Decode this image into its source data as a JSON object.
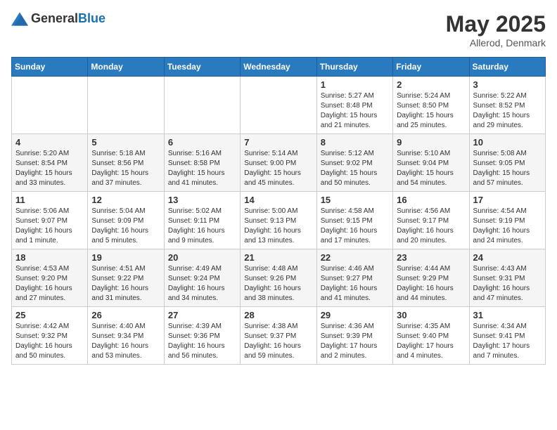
{
  "header": {
    "logo_general": "General",
    "logo_blue": "Blue",
    "month_title": "May 2025",
    "subtitle": "Allerod, Denmark"
  },
  "weekdays": [
    "Sunday",
    "Monday",
    "Tuesday",
    "Wednesday",
    "Thursday",
    "Friday",
    "Saturday"
  ],
  "weeks": [
    [
      {
        "day": "",
        "info": ""
      },
      {
        "day": "",
        "info": ""
      },
      {
        "day": "",
        "info": ""
      },
      {
        "day": "",
        "info": ""
      },
      {
        "day": "1",
        "info": "Sunrise: 5:27 AM\nSunset: 8:48 PM\nDaylight: 15 hours\nand 21 minutes."
      },
      {
        "day": "2",
        "info": "Sunrise: 5:24 AM\nSunset: 8:50 PM\nDaylight: 15 hours\nand 25 minutes."
      },
      {
        "day": "3",
        "info": "Sunrise: 5:22 AM\nSunset: 8:52 PM\nDaylight: 15 hours\nand 29 minutes."
      }
    ],
    [
      {
        "day": "4",
        "info": "Sunrise: 5:20 AM\nSunset: 8:54 PM\nDaylight: 15 hours\nand 33 minutes."
      },
      {
        "day": "5",
        "info": "Sunrise: 5:18 AM\nSunset: 8:56 PM\nDaylight: 15 hours\nand 37 minutes."
      },
      {
        "day": "6",
        "info": "Sunrise: 5:16 AM\nSunset: 8:58 PM\nDaylight: 15 hours\nand 41 minutes."
      },
      {
        "day": "7",
        "info": "Sunrise: 5:14 AM\nSunset: 9:00 PM\nDaylight: 15 hours\nand 45 minutes."
      },
      {
        "day": "8",
        "info": "Sunrise: 5:12 AM\nSunset: 9:02 PM\nDaylight: 15 hours\nand 50 minutes."
      },
      {
        "day": "9",
        "info": "Sunrise: 5:10 AM\nSunset: 9:04 PM\nDaylight: 15 hours\nand 54 minutes."
      },
      {
        "day": "10",
        "info": "Sunrise: 5:08 AM\nSunset: 9:05 PM\nDaylight: 15 hours\nand 57 minutes."
      }
    ],
    [
      {
        "day": "11",
        "info": "Sunrise: 5:06 AM\nSunset: 9:07 PM\nDaylight: 16 hours\nand 1 minute."
      },
      {
        "day": "12",
        "info": "Sunrise: 5:04 AM\nSunset: 9:09 PM\nDaylight: 16 hours\nand 5 minutes."
      },
      {
        "day": "13",
        "info": "Sunrise: 5:02 AM\nSunset: 9:11 PM\nDaylight: 16 hours\nand 9 minutes."
      },
      {
        "day": "14",
        "info": "Sunrise: 5:00 AM\nSunset: 9:13 PM\nDaylight: 16 hours\nand 13 minutes."
      },
      {
        "day": "15",
        "info": "Sunrise: 4:58 AM\nSunset: 9:15 PM\nDaylight: 16 hours\nand 17 minutes."
      },
      {
        "day": "16",
        "info": "Sunrise: 4:56 AM\nSunset: 9:17 PM\nDaylight: 16 hours\nand 20 minutes."
      },
      {
        "day": "17",
        "info": "Sunrise: 4:54 AM\nSunset: 9:19 PM\nDaylight: 16 hours\nand 24 minutes."
      }
    ],
    [
      {
        "day": "18",
        "info": "Sunrise: 4:53 AM\nSunset: 9:20 PM\nDaylight: 16 hours\nand 27 minutes."
      },
      {
        "day": "19",
        "info": "Sunrise: 4:51 AM\nSunset: 9:22 PM\nDaylight: 16 hours\nand 31 minutes."
      },
      {
        "day": "20",
        "info": "Sunrise: 4:49 AM\nSunset: 9:24 PM\nDaylight: 16 hours\nand 34 minutes."
      },
      {
        "day": "21",
        "info": "Sunrise: 4:48 AM\nSunset: 9:26 PM\nDaylight: 16 hours\nand 38 minutes."
      },
      {
        "day": "22",
        "info": "Sunrise: 4:46 AM\nSunset: 9:27 PM\nDaylight: 16 hours\nand 41 minutes."
      },
      {
        "day": "23",
        "info": "Sunrise: 4:44 AM\nSunset: 9:29 PM\nDaylight: 16 hours\nand 44 minutes."
      },
      {
        "day": "24",
        "info": "Sunrise: 4:43 AM\nSunset: 9:31 PM\nDaylight: 16 hours\nand 47 minutes."
      }
    ],
    [
      {
        "day": "25",
        "info": "Sunrise: 4:42 AM\nSunset: 9:32 PM\nDaylight: 16 hours\nand 50 minutes."
      },
      {
        "day": "26",
        "info": "Sunrise: 4:40 AM\nSunset: 9:34 PM\nDaylight: 16 hours\nand 53 minutes."
      },
      {
        "day": "27",
        "info": "Sunrise: 4:39 AM\nSunset: 9:36 PM\nDaylight: 16 hours\nand 56 minutes."
      },
      {
        "day": "28",
        "info": "Sunrise: 4:38 AM\nSunset: 9:37 PM\nDaylight: 16 hours\nand 59 minutes."
      },
      {
        "day": "29",
        "info": "Sunrise: 4:36 AM\nSunset: 9:39 PM\nDaylight: 17 hours\nand 2 minutes."
      },
      {
        "day": "30",
        "info": "Sunrise: 4:35 AM\nSunset: 9:40 PM\nDaylight: 17 hours\nand 4 minutes."
      },
      {
        "day": "31",
        "info": "Sunrise: 4:34 AM\nSunset: 9:41 PM\nDaylight: 17 hours\nand 7 minutes."
      }
    ]
  ]
}
